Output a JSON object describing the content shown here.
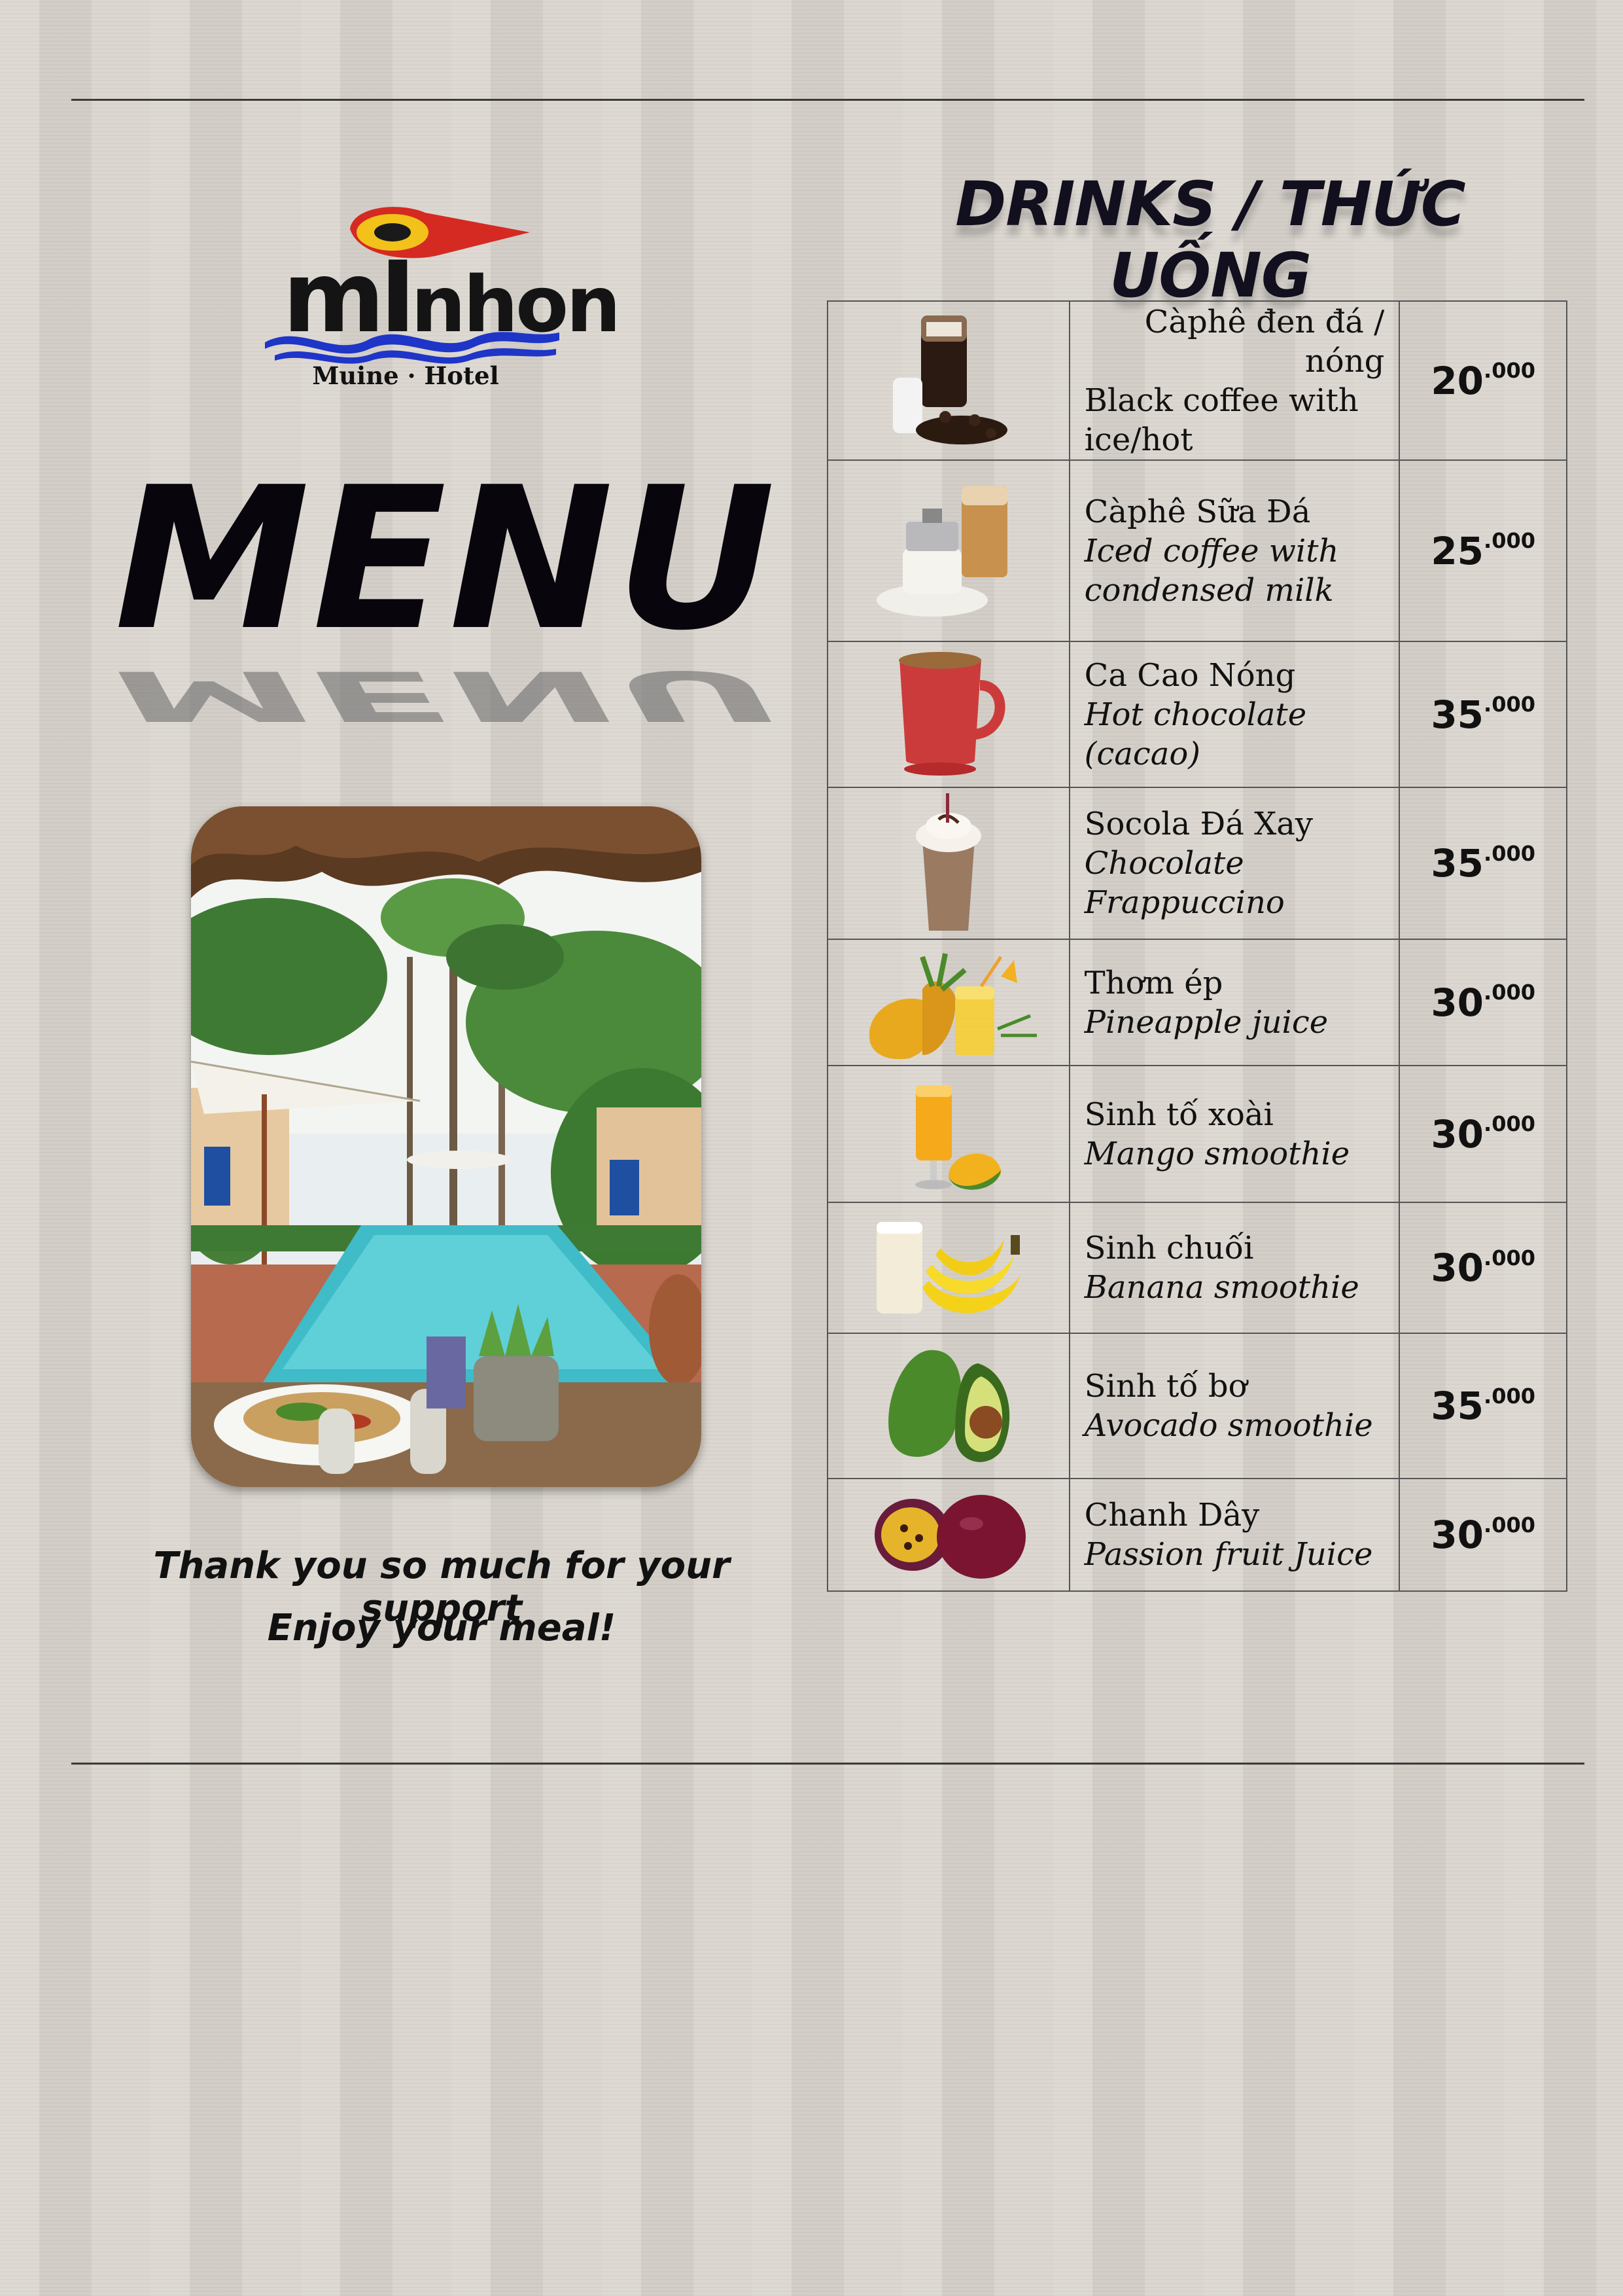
{
  "logo": {
    "word_big": "mI",
    "word_small": "nhon",
    "subtitle": "Muine · Hotel"
  },
  "menu_title": "MENU",
  "thanks": {
    "line1": "Thank you so much for your support",
    "line2": "Enjoy your meal!"
  },
  "drinks_title": "DRINKS / THỨC UỐNG",
  "drinks": [
    {
      "vn": "Càphê đen đá / nóng",
      "en": "Black coffee with ice/hot",
      "price_main": "20",
      "price_sup": ".000",
      "icon": "black-coffee-icon"
    },
    {
      "vn": "Càphê Sữa Đá",
      "en": "Iced coffee with condensed milk",
      "price_main": "25",
      "price_sup": ".000",
      "icon": "iced-milk-coffee-icon"
    },
    {
      "vn": "Ca Cao Nóng",
      "en": "Hot chocolate (cacao)",
      "price_main": "35",
      "price_sup": ".000",
      "icon": "hot-chocolate-mug-icon"
    },
    {
      "vn": "Socola Đá Xay",
      "en": "Chocolate Frappuccino",
      "price_main": "35",
      "price_sup": ".000",
      "icon": "frappuccino-icon"
    },
    {
      "vn": "Thơm ép",
      "en": "Pineapple juice",
      "price_main": "30",
      "price_sup": ".000",
      "icon": "pineapple-juice-icon"
    },
    {
      "vn": "Sinh tố xoài",
      "en": "Mango smoothie",
      "price_main": "30",
      "price_sup": ".000",
      "icon": "mango-smoothie-icon"
    },
    {
      "vn": "Sinh chuối",
      "en": "Banana smoothie",
      "price_main": "30",
      "price_sup": ".000",
      "icon": "banana-smoothie-icon"
    },
    {
      "vn": "Sinh tố bơ",
      "en": "Avocado smoothie",
      "price_main": "35",
      "price_sup": ".000",
      "icon": "avocado-icon"
    },
    {
      "vn": "Chanh Dây",
      "en": "Passion fruit Juice",
      "price_main": "30",
      "price_sup": ".000",
      "icon": "passion-fruit-icon"
    }
  ],
  "colors": {
    "logo_red": "#d42a22",
    "logo_blue": "#1e35c8",
    "logo_yellow": "#f2c21a",
    "text_dark": "#111111"
  }
}
